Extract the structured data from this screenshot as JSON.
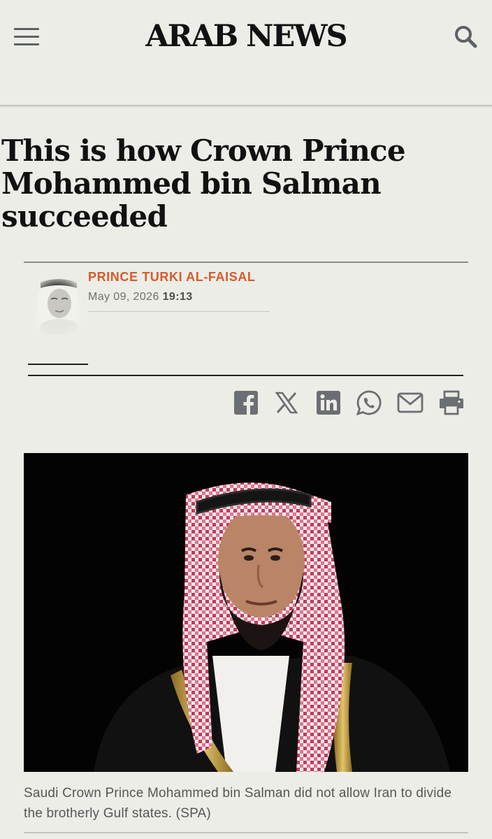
{
  "header": {
    "logo": "ARAB NEWS",
    "menu_icon": "hamburger-menu-icon",
    "search_icon": "search-icon"
  },
  "article": {
    "headline": "This is how Crown Prince Mohammed bin Salman succeeded",
    "author": {
      "name": "PRINCE TURKI AL-FAISAL",
      "date": "May 09, 2026",
      "time": "19:13"
    },
    "share": {
      "icons": [
        "facebook-icon",
        "x-icon",
        "linkedin-icon",
        "whatsapp-icon",
        "email-icon",
        "print-icon"
      ],
      "color": "#6b6e72"
    },
    "image_caption": "Saudi Crown Prince Mohammed bin Salman did not allow Iran to divide the brotherly Gulf states. (SPA)"
  },
  "colors": {
    "background": "#ecede6",
    "author_accent": "#d65a2f"
  }
}
